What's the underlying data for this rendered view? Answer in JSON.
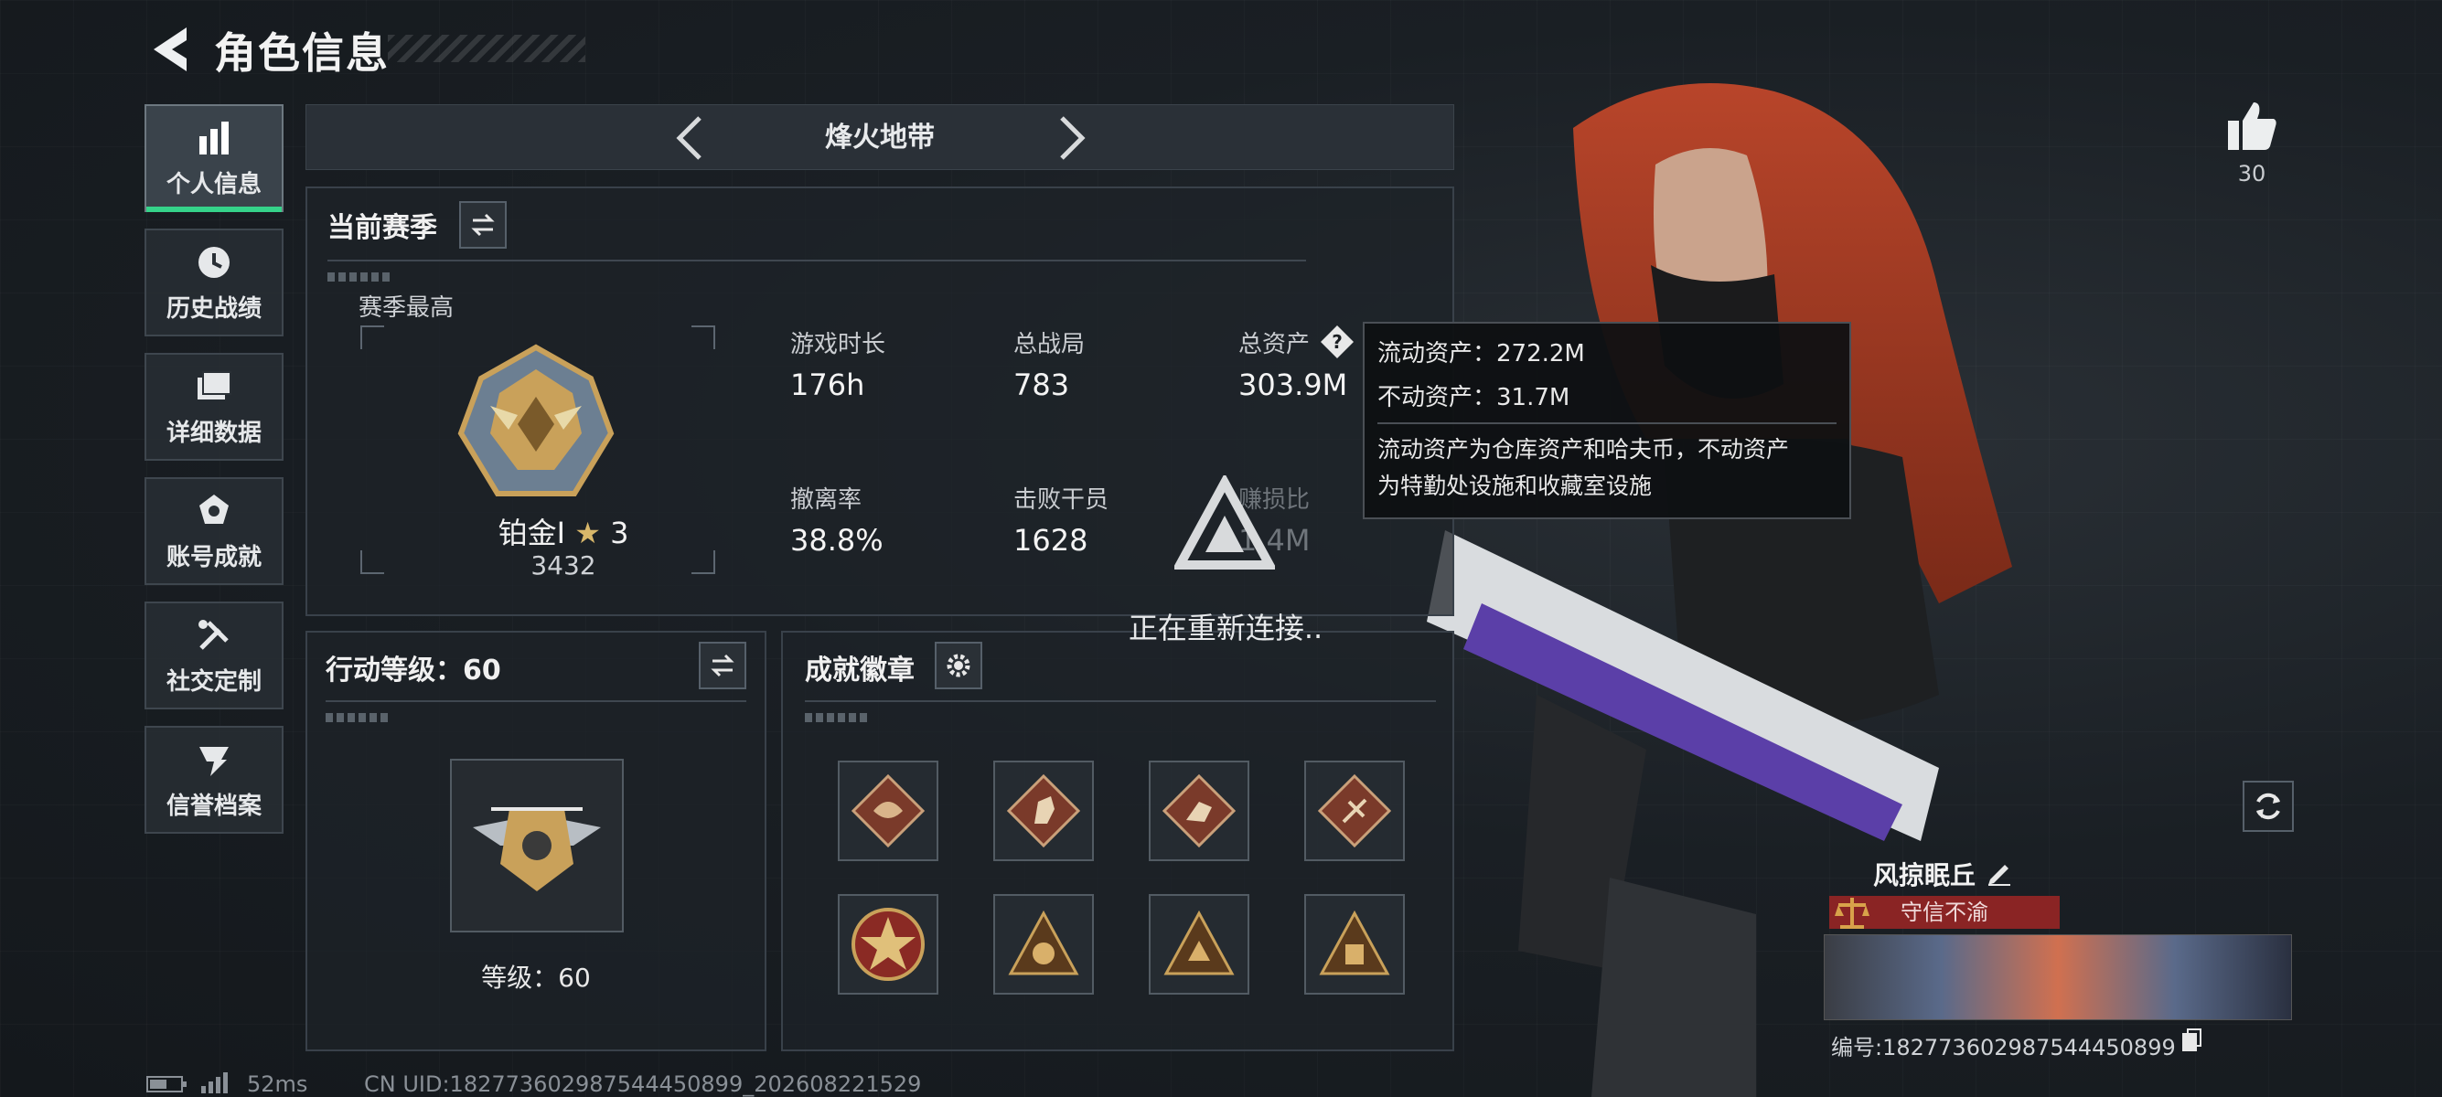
{
  "header": {
    "title": "角色信息"
  },
  "sidebar": {
    "items": [
      {
        "label": "个人信息",
        "icon": "bar-chart-icon",
        "active": true
      },
      {
        "label": "历史战绩",
        "icon": "clock-icon"
      },
      {
        "label": "详细数据",
        "icon": "folder-icon"
      },
      {
        "label": "账号成就",
        "icon": "medal-icon"
      },
      {
        "label": "社交定制",
        "icon": "wrench-icon"
      },
      {
        "label": "信誉档案",
        "icon": "reputation-icon"
      }
    ]
  },
  "mode": {
    "name": "烽火地带"
  },
  "season": {
    "title": "当前赛季",
    "highest_label": "赛季最高",
    "rank_name": "铂金Ⅰ",
    "rank_stars": "3",
    "rank_score": "3432",
    "stats": [
      {
        "label": "游戏时长",
        "value": "176h"
      },
      {
        "label": "总战局",
        "value": "783"
      },
      {
        "label": "总资产",
        "value": "303.9M"
      },
      {
        "label": "撤离率",
        "value": "38.8%"
      },
      {
        "label": "击败干员",
        "value": "1628"
      },
      {
        "label": "赚损比",
        "value": "1.4M"
      }
    ]
  },
  "tooltip": {
    "liquid": "流动资产：272.2M",
    "fixed": "不动资产：31.7M",
    "desc_line1": "流动资产为仓库资产和哈夫币，不动资产",
    "desc_line2": "为特勤处设施和收藏室设施"
  },
  "reconnect": {
    "text": "正在重新连接.."
  },
  "level": {
    "title": "行动等级：60",
    "caption": "等级：60"
  },
  "achievements": {
    "title": "成就徽章",
    "count": 8
  },
  "likes": {
    "count": "30"
  },
  "profile": {
    "name": "风掠眠丘",
    "tag": "守信不渝",
    "id": "编号:182773602987544450899"
  },
  "status_bar": {
    "ping": "52ms",
    "uid": "CN UID:182773602987544450899_202608221529"
  },
  "colors": {
    "accent_green": "#35d38a",
    "tag_red": "#8a2424",
    "gold": "#c9a15a"
  }
}
